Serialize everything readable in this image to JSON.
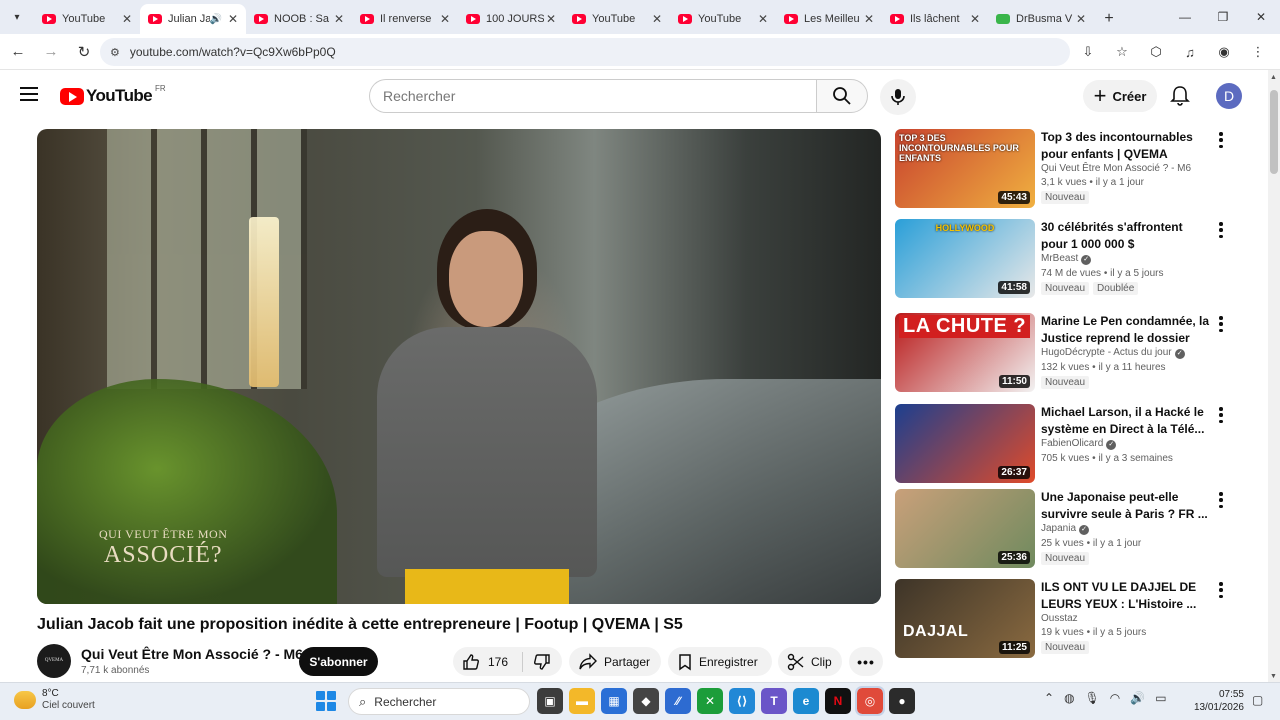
{
  "browser": {
    "tabs": [
      {
        "title": "YouTube",
        "icon": "youtube-icon",
        "active": false
      },
      {
        "title": "Julian Jacob",
        "icon": "youtube-icon",
        "active": true,
        "audio": true
      },
      {
        "title": "NOOB : Sa",
        "icon": "youtube-icon",
        "active": false
      },
      {
        "title": "Il renverse",
        "icon": "youtube-icon",
        "active": false
      },
      {
        "title": "100 JOURS",
        "icon": "youtube-icon",
        "active": false
      },
      {
        "title": "YouTube",
        "icon": "youtube-icon",
        "active": false
      },
      {
        "title": "YouTube",
        "icon": "youtube-icon",
        "active": false
      },
      {
        "title": "Les Meilleu",
        "icon": "youtube-icon",
        "active": false
      },
      {
        "title": "Ils lâchent",
        "icon": "youtube-icon",
        "active": false
      },
      {
        "title": "DrBusma V",
        "icon": "green-favicon",
        "active": false
      }
    ],
    "url": "youtube.com/watch?v=Qc9Xw6bPp0Q"
  },
  "header": {
    "logo_text": "YouTube",
    "country_code": "FR",
    "search_placeholder": "Rechercher",
    "create_label": "Créer",
    "avatar_letter": "D"
  },
  "player": {
    "watermark_line1": "QUI VEUT ÊTRE MON",
    "watermark_line2": "ASSOCIÉ?"
  },
  "video": {
    "title": "Julian Jacob fait une proposition inédite à cette entrepreneure | Footup | QVEMA | S5",
    "channel_name": "Qui Veut Être Mon Associé ? - M6",
    "subscribers": "7,71 k abonnés",
    "subscribe_label": "S'abonner",
    "likes": "176",
    "share_label": "Partager",
    "save_label": "Enregistrer",
    "clip_label": "Clip"
  },
  "recommendations": [
    {
      "title": "Top 3 des incontournables pour enfants | QVEMA",
      "channel": "Qui Veut Être Mon Associé ? - M6",
      "verified": false,
      "views": "3,1 k vues",
      "age": "il y a 1 jour",
      "badges": [
        "Nouveau"
      ],
      "duration": "45:43",
      "thumb_text": "TOP 3 DES INCONTOURNABLES POUR ENFANTS",
      "thumb_colors": [
        "#c8432e",
        "#f0b040"
      ]
    },
    {
      "title": "30 célébrités s'affrontent pour 1 000 000 $",
      "channel": "MrBeast",
      "verified": true,
      "views": "74 M de vues",
      "age": "il y a 5 jours",
      "badges": [
        "Nouveau",
        "Doublée"
      ],
      "duration": "41:58",
      "thumb_text": "HOLLYWOOD",
      "thumb_colors": [
        "#2a9fd8",
        "#e8e8e8"
      ]
    },
    {
      "title": "Marine Le Pen condamnée, la Justice reprend le dossier",
      "channel": "HugoDécrypte - Actus du jour",
      "verified": true,
      "views": "132 k vues",
      "age": "il y a 11 heures",
      "badges": [
        "Nouveau"
      ],
      "duration": "11:50",
      "thumb_text": "LA CHUTE ?",
      "thumb_colors": [
        "#b81818",
        "#f2f2f2"
      ]
    },
    {
      "title": "Michael Larson, il a Hacké le système en Direct à la Télé...",
      "channel": "FabienOlicard",
      "verified": true,
      "views": "705 k vues",
      "age": "il y a 3 semaines",
      "badges": [],
      "duration": "26:37",
      "thumb_text": "",
      "thumb_colors": [
        "#1c3f8f",
        "#e04b2a"
      ]
    },
    {
      "title": "Une Japonaise peut-elle survivre seule à Paris ? FR ...",
      "channel": "Japania",
      "verified": true,
      "views": "25 k vues",
      "age": "il y a 1 jour",
      "badges": [
        "Nouveau"
      ],
      "duration": "25:36",
      "thumb_text": "",
      "thumb_colors": [
        "#c9a07a",
        "#6f8a5e"
      ]
    },
    {
      "title": "ILS ONT VU LE DAJJEL DE LEURS YEUX : L'Histoire ...",
      "channel": "Ousstaz",
      "verified": false,
      "views": "19 k vues",
      "age": "il y a 5 jours",
      "badges": [
        "Nouveau"
      ],
      "duration": "11:25",
      "thumb_text": "DAJJAL",
      "thumb_colors": [
        "#3d3428",
        "#8a6a40"
      ]
    }
  ],
  "taskbar": {
    "temperature": "8°C",
    "weather": "Ciel couvert",
    "search_label": "Rechercher",
    "time": "07:55",
    "date": "13/01/2026"
  }
}
